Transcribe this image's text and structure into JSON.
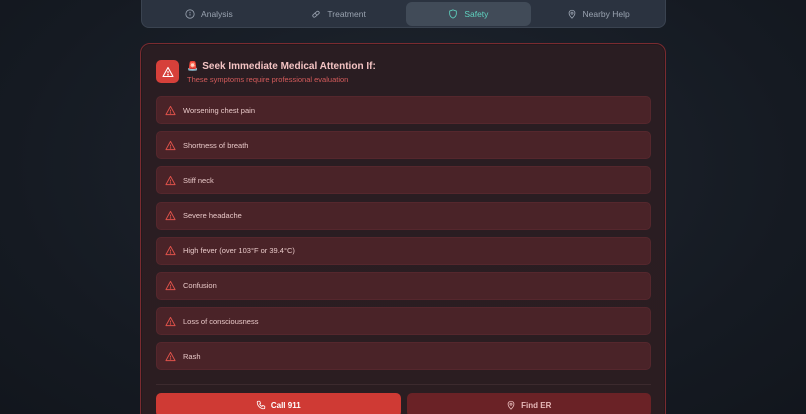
{
  "tabs": [
    {
      "label": "Analysis",
      "icon": "info-circle-icon",
      "active": false
    },
    {
      "label": "Treatment",
      "icon": "pill-icon",
      "active": false
    },
    {
      "label": "Safety",
      "icon": "shield-icon",
      "active": true
    },
    {
      "label": "Nearby Help",
      "icon": "map-pin-icon",
      "active": false
    }
  ],
  "alert": {
    "title_emoji": "🚨",
    "title": "Seek Immediate Medical Attention If:",
    "subtitle": "These symptoms require professional evaluation"
  },
  "symptoms": [
    "Worsening chest pain",
    "Shortness of breath",
    "Stiff neck",
    "Severe headache",
    "High fever (over 103°F or 39.4°C)",
    "Confusion",
    "Loss of consciousness",
    "Rash"
  ],
  "actions": {
    "call_label": "Call 911",
    "find_label": "Find ER"
  },
  "colors": {
    "accent_teal": "#5fd3c0",
    "alert_red": "#d6403a",
    "panel_border": "#7a2b30"
  }
}
